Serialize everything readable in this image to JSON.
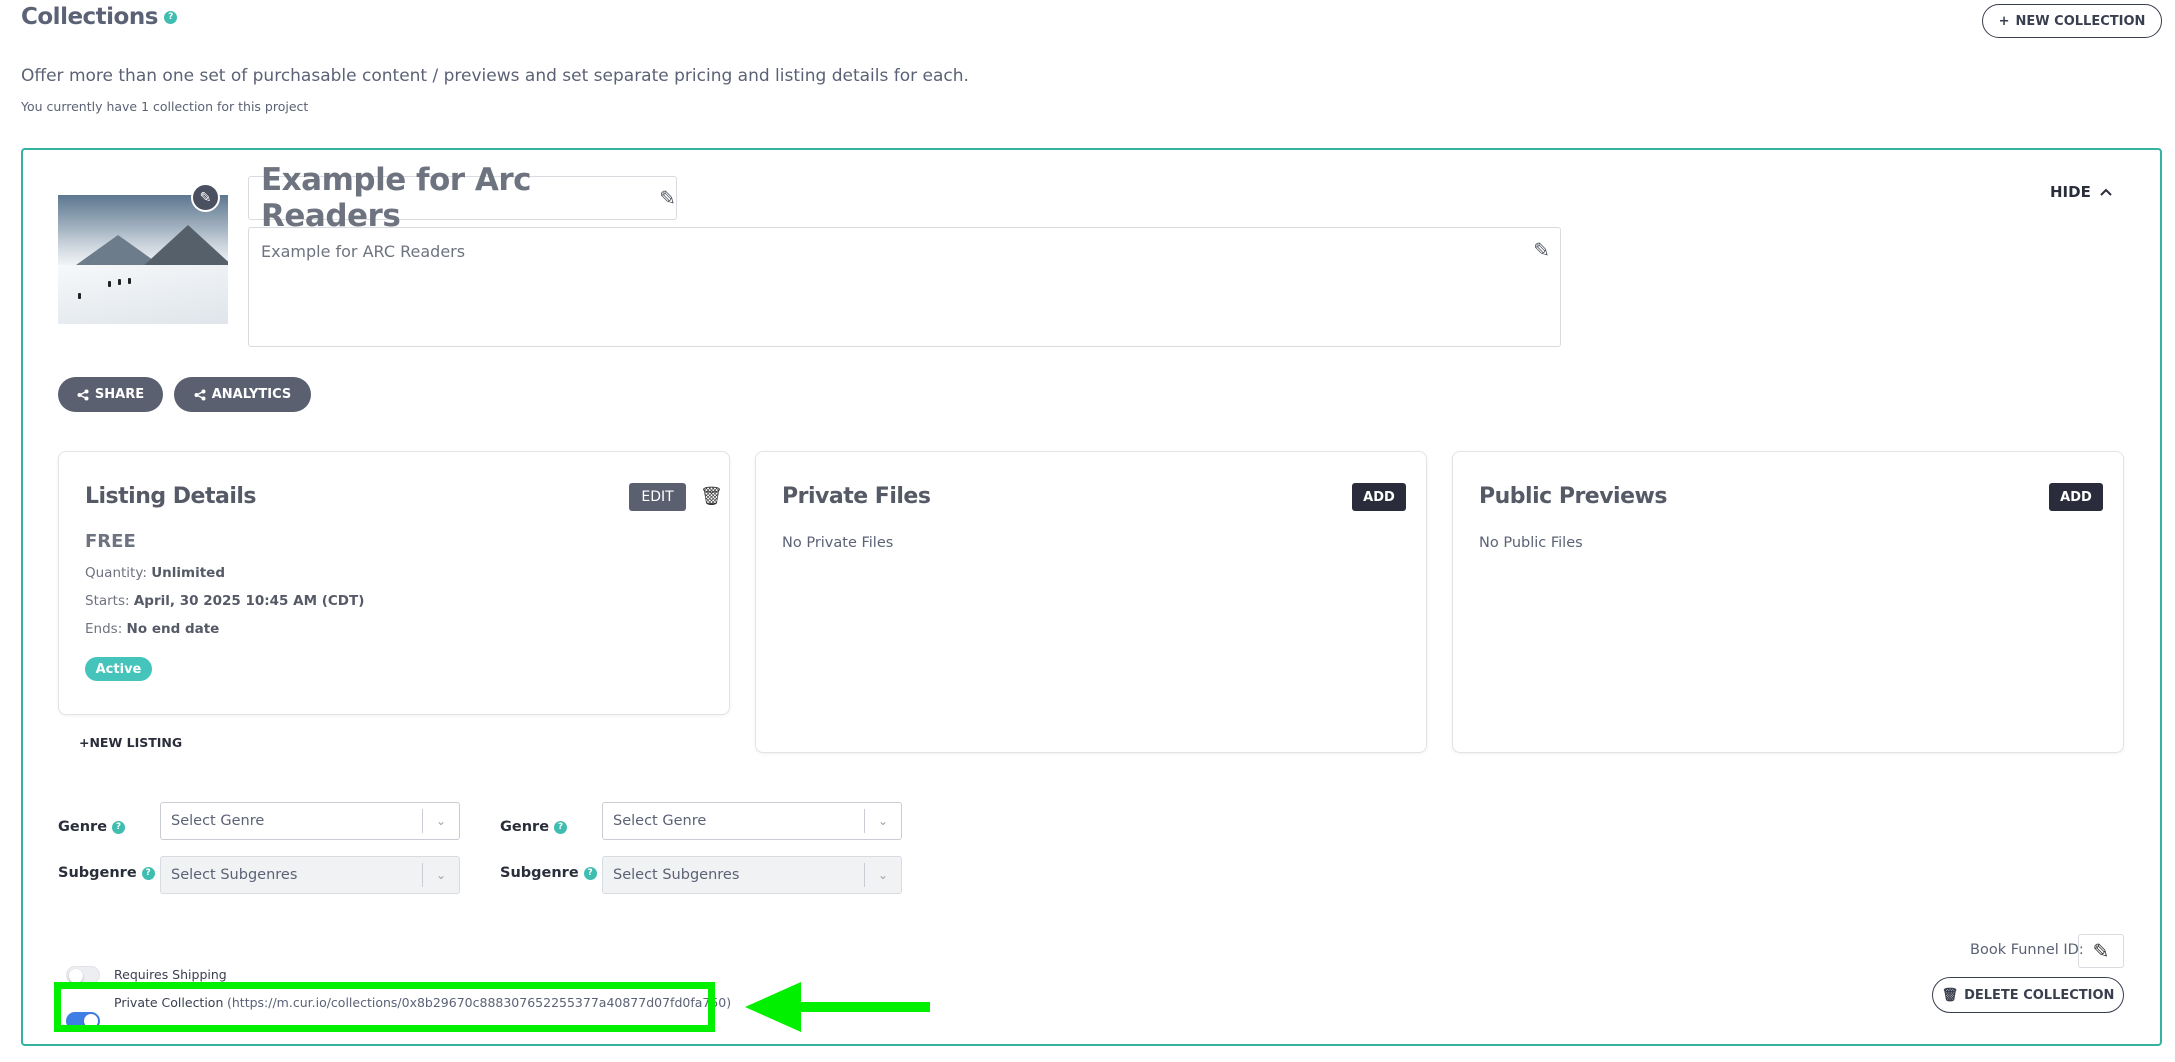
{
  "header": {
    "title": "Collections",
    "help": "?",
    "new_collection_label": "NEW COLLECTION",
    "intro": "Offer more than one set of purchasable content / previews and set separate pricing and listing details for each.",
    "count_note": "You currently have 1 collection for this project"
  },
  "collection": {
    "title": "Example for Arc Readers",
    "description": "Example for ARC Readers",
    "hide_label": "HIDE",
    "share_label": "SHARE",
    "analytics_label": "ANALYTICS",
    "listing": {
      "title": "Listing Details",
      "edit_label": "EDIT",
      "price": "FREE",
      "quantity_label": "Quantity:",
      "quantity_value": "Unlimited",
      "starts_label": "Starts:",
      "starts_value": "April, 30 2025 10:45 AM (CDT)",
      "ends_label": "Ends:",
      "ends_value": "No end date",
      "status": "Active",
      "new_listing_label": "+NEW LISTING"
    },
    "private_files": {
      "title": "Private Files",
      "add_label": "ADD",
      "empty": "No Private Files"
    },
    "public_previews": {
      "title": "Public Previews",
      "add_label": "ADD",
      "empty": "No Public Files"
    },
    "genre_groups": [
      {
        "genre_label": "Genre",
        "genre_placeholder": "Select Genre",
        "subgenre_label": "Subgenre",
        "subgenre_placeholder": "Select Subgenres"
      },
      {
        "genre_label": "Genre",
        "genre_placeholder": "Select Genre",
        "subgenre_label": "Subgenre",
        "subgenre_placeholder": "Select Subgenres"
      }
    ],
    "requires_shipping_label": "Requires Shipping",
    "requires_shipping_on": false,
    "private_collection_label": "Private Collection",
    "private_collection_on": true,
    "private_collection_url": "(https://m.cur.io/collections/0x8b29670c888307652255377a40877d07fd0fa750)",
    "book_funnel_label": "Book Funnel ID:",
    "delete_label": "DELETE COLLECTION"
  },
  "colors": {
    "accent": "#34b3a3",
    "highlight": "#00f000",
    "toggle_on": "#3f7fe5",
    "dark_button": "#2a2c3b"
  }
}
